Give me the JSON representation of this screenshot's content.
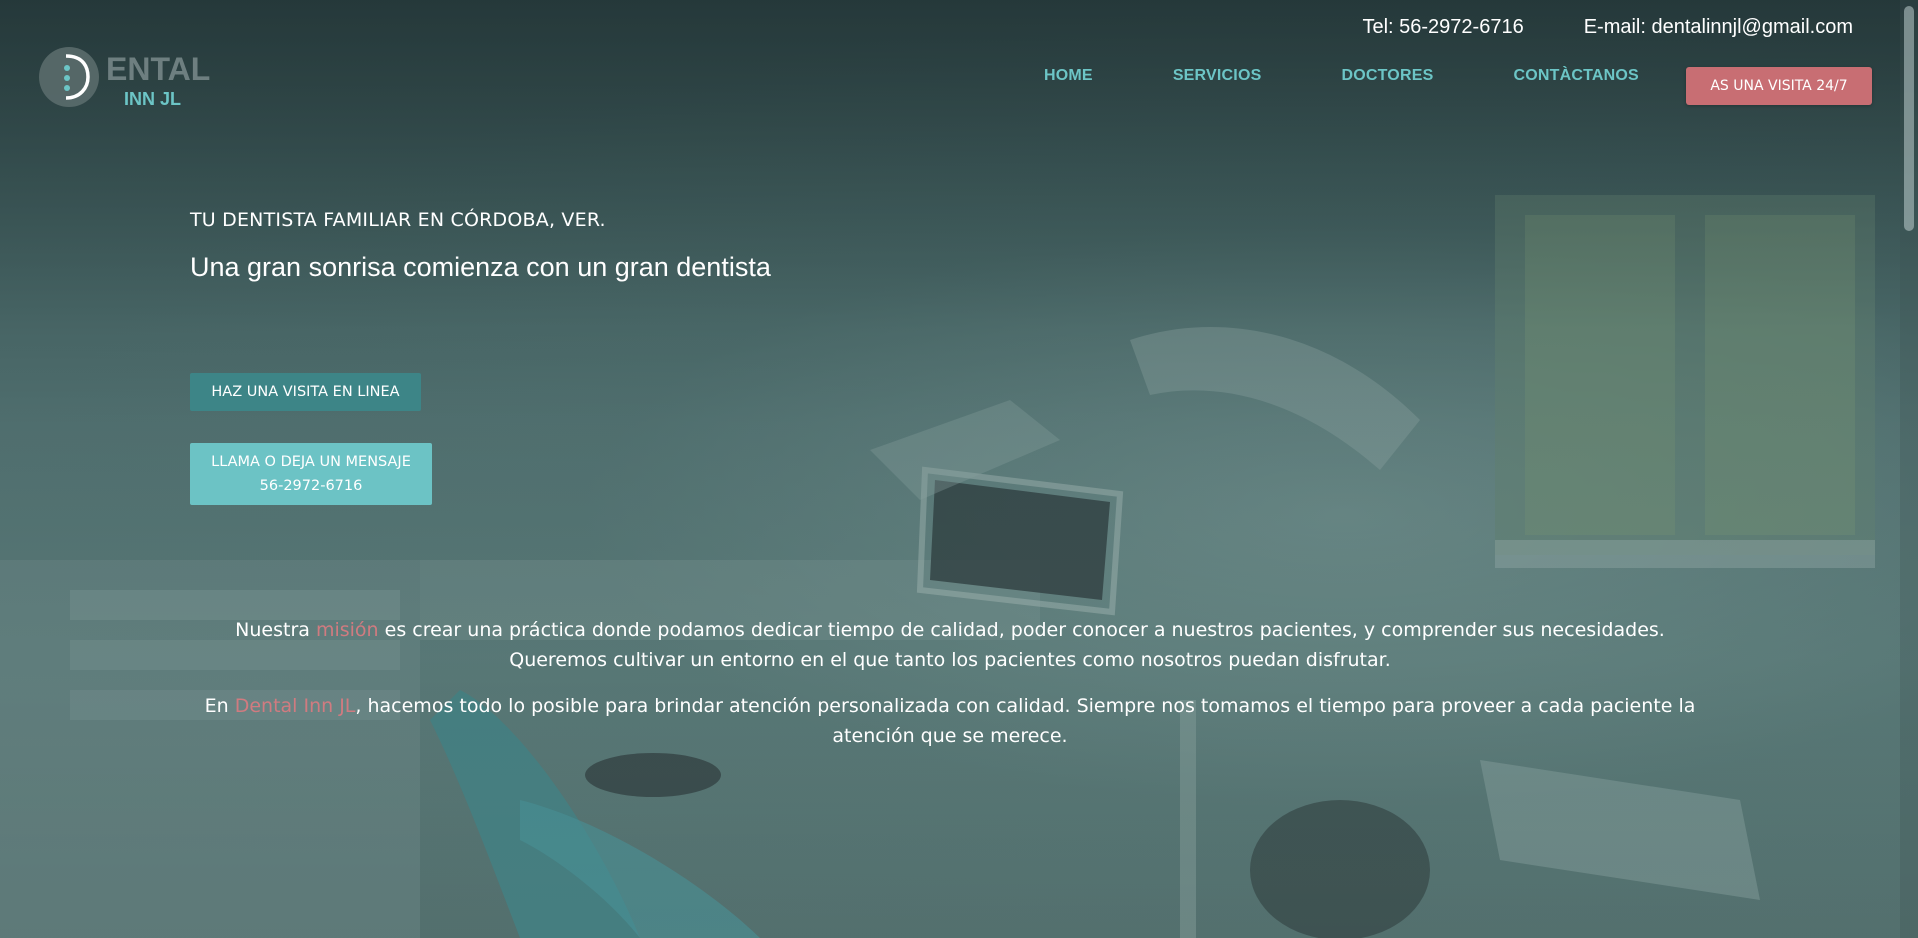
{
  "header": {
    "phone": "Tel: 56-2972-6716",
    "email": "E-mail: dentalinnjl@gmail.com",
    "logo_text_top": "ENTAL",
    "logo_text_bottom": "INN JL"
  },
  "nav": {
    "items": [
      "HOME",
      "SERVICIOS",
      "DOCTORES",
      "CONTÀCTANOS"
    ],
    "cta": "AS UNA VISITA 24/7"
  },
  "hero": {
    "tagline": "TU DENTISTA FAMILIAR EN CÓRDOBA, VER.",
    "headline": "Una gran sonrisa comienza con un gran dentista",
    "btn_online": "HAZ UNA VISITA EN LINEA",
    "btn_call_line1": "LLAMA O DEJA UN MENSAJE",
    "btn_call_line2": "56-2972-6716"
  },
  "mission": {
    "p1_before": "Nuestra ",
    "p1_accent": "misión",
    "p1_after": " es crear una práctica donde podamos dedicar tiempo de calidad, poder conocer a nuestros pacientes, y comprender sus necesidades. Queremos cultivar un entorno en el que tanto los pacientes como nosotros puedan disfrutar.",
    "p2_before": "En ",
    "p2_accent": "Dental Inn JL",
    "p2_after": ", hacemos todo lo posible para brindar atención personalizada con calidad. Siempre nos tomamos el tiempo para proveer a cada paciente la atención que se merece."
  },
  "colors": {
    "nav_link": "#6cc5c6",
    "cta_red": "#c86e73",
    "btn_dark_teal": "#3d8587",
    "btn_light_teal": "#6cc3c5",
    "accent_text": "#d07b80"
  }
}
